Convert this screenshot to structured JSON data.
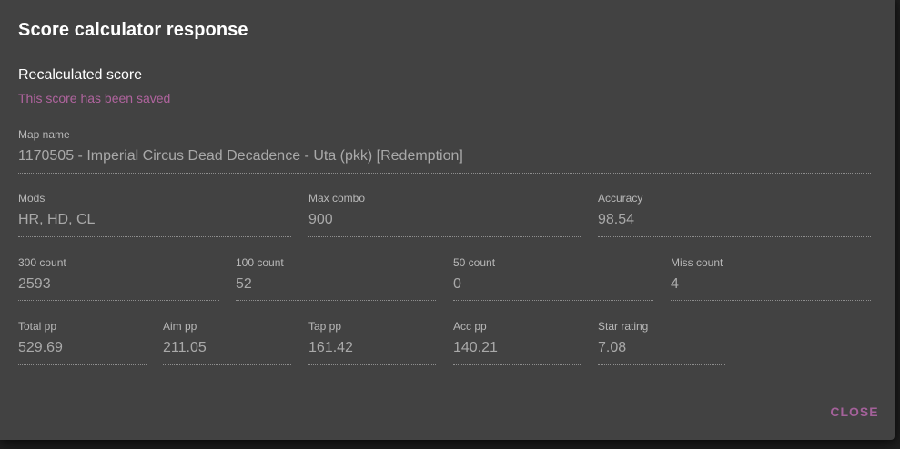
{
  "dialog": {
    "title": "Score calculator response",
    "subheading": "Recalculated score",
    "saved_message": "This score has been saved",
    "close_label": "CLOSE"
  },
  "fields": {
    "map_name": {
      "label": "Map name",
      "value": "1170505 - Imperial Circus Dead Decadence - Uta (pkk) [Redemption]"
    },
    "mods": {
      "label": "Mods",
      "value": "HR, HD, CL"
    },
    "max_combo": {
      "label": "Max combo",
      "value": "900"
    },
    "accuracy": {
      "label": "Accuracy",
      "value": "98.54"
    },
    "count_300": {
      "label": "300 count",
      "value": "2593"
    },
    "count_100": {
      "label": "100 count",
      "value": "52"
    },
    "count_50": {
      "label": "50 count",
      "value": "0"
    },
    "miss_count": {
      "label": "Miss count",
      "value": "4"
    },
    "total_pp": {
      "label": "Total pp",
      "value": "529.69"
    },
    "aim_pp": {
      "label": "Aim pp",
      "value": "211.05"
    },
    "tap_pp": {
      "label": "Tap pp",
      "value": "161.42"
    },
    "acc_pp": {
      "label": "Acc pp",
      "value": "140.21"
    },
    "star_rating": {
      "label": "Star rating",
      "value": "7.08"
    }
  },
  "colors": {
    "dialog_bg": "#424242",
    "accent": "#b0649e",
    "backdrop": "#1f1f1f"
  }
}
